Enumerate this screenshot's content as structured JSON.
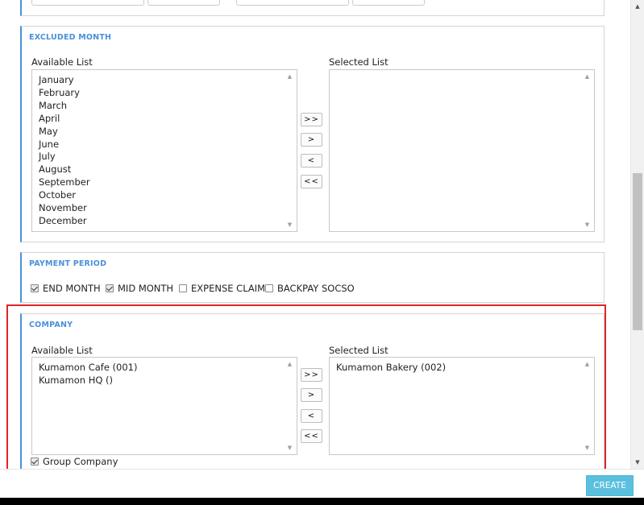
{
  "excluded_month": {
    "title": "EXCLUDED MONTH",
    "available_label": "Available List",
    "selected_label": "Selected List",
    "available_items": [
      "January",
      "February",
      "March",
      "April",
      "May",
      "June",
      "July",
      "August",
      "September",
      "October",
      "November",
      "December"
    ],
    "selected_items": []
  },
  "move_buttons": {
    "add_all": ">>",
    "add": ">",
    "remove": "<",
    "remove_all": "<<"
  },
  "payment_period": {
    "title": "PAYMENT PERIOD",
    "options": [
      {
        "label": "END MONTH",
        "checked": true
      },
      {
        "label": "MID MONTH",
        "checked": true
      },
      {
        "label": "EXPENSE CLAIM",
        "checked": false
      },
      {
        "label": "BACKPAY SOCSO",
        "checked": false
      }
    ]
  },
  "company": {
    "title": "COMPANY",
    "available_label": "Available List",
    "selected_label": "Selected List",
    "available_items": [
      "Kumamon Cafe (001)",
      "Kumamon HQ ()"
    ],
    "selected_items": [
      "Kumamon Bakery (002)"
    ],
    "group_company": {
      "label": "Group Company",
      "checked": true
    }
  },
  "footer": {
    "create_label": "CREATE"
  },
  "colors": {
    "accent": "#4a90d9",
    "highlight": "#e0242b",
    "create_button": "#5bc0de"
  }
}
